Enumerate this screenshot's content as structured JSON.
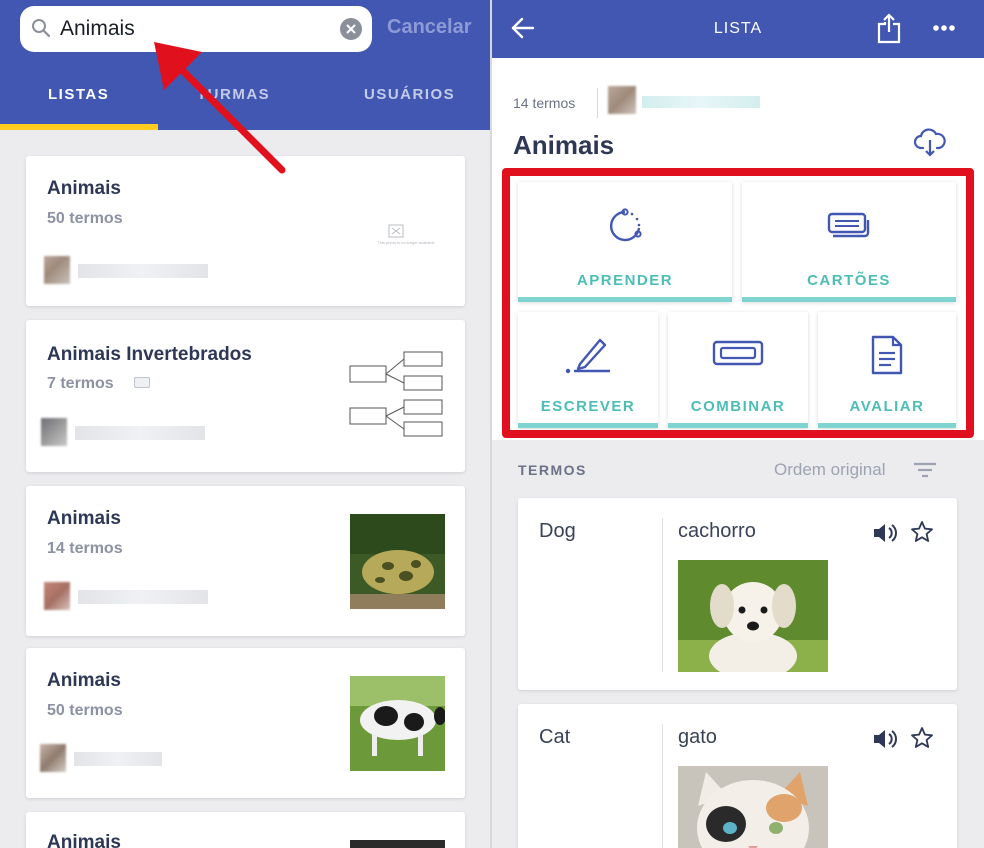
{
  "search": {
    "query": "Animais",
    "cancel_label": "Cancelar"
  },
  "tabs": [
    {
      "label": "LISTAS",
      "active": true
    },
    {
      "label": "TURMAS",
      "active": false
    },
    {
      "label": "USUÁRIOS",
      "active": false
    }
  ],
  "results": [
    {
      "title": "Animais",
      "count": "50 termos",
      "thumbnail": "no-image-placeholder",
      "thumbnail_caption": "This photo is no longer available"
    },
    {
      "title": "Animais Invertebrados",
      "count": "7 termos",
      "thumbnail": "diagram"
    },
    {
      "title": "Animais",
      "count": "14 termos",
      "thumbnail": "frog-photo"
    },
    {
      "title": "Animais",
      "count": "50 termos",
      "thumbnail": "cow-photo"
    },
    {
      "title": "Animais",
      "count": "",
      "thumbnail": "dark-photo"
    }
  ],
  "detail": {
    "header_title": "LISTA",
    "terms_count": "14 termos",
    "list_title": "Animais",
    "modes": [
      {
        "label": "APRENDER",
        "icon": "learn-icon"
      },
      {
        "label": "CARTÕES",
        "icon": "flashcards-icon"
      },
      {
        "label": "ESCREVER",
        "icon": "write-icon"
      },
      {
        "label": "COMBINAR",
        "icon": "match-icon"
      },
      {
        "label": "AVALIAR",
        "icon": "test-icon"
      }
    ],
    "terms_heading": "TERMOS",
    "order_label": "Ordem original",
    "terms": [
      {
        "term": "Dog",
        "definition": "cachorro",
        "image": "puppy-photo"
      },
      {
        "term": "Cat",
        "definition": "gato",
        "image": "cat-photo"
      }
    ]
  },
  "colors": {
    "header_blue": "#4257b2",
    "accent_yellow": "#ffcd1f",
    "mode_teal": "#4cbdb7",
    "highlight_red": "#e0101e",
    "arrow_red": "#e1101d"
  }
}
